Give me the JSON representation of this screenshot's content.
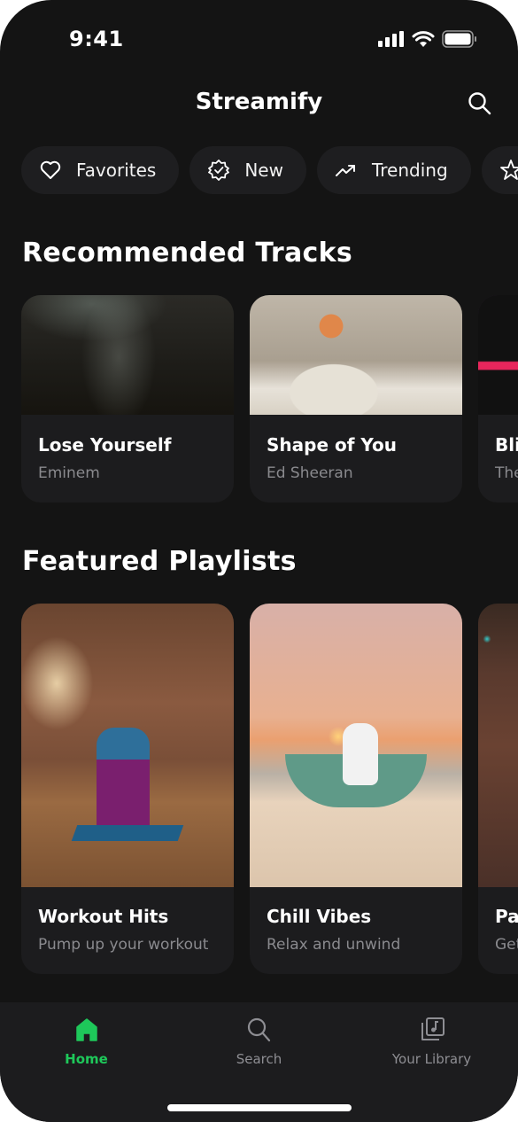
{
  "status_bar": {
    "time": "9:41"
  },
  "header": {
    "title": "Streamify"
  },
  "chips": [
    {
      "label": "Favorites",
      "icon": "heart-icon"
    },
    {
      "label": "New",
      "icon": "badge-check-icon"
    },
    {
      "label": "Trending",
      "icon": "trending-up-icon"
    },
    {
      "label": "",
      "icon": "star-icon"
    }
  ],
  "recommended": {
    "title": "Recommended Tracks",
    "items": [
      {
        "title": "Lose Yourself",
        "artist": "Eminem"
      },
      {
        "title": "Shape of You",
        "artist": "Ed Sheeran"
      },
      {
        "title": "Blinding Lights",
        "artist": "The Weeknd"
      }
    ]
  },
  "featured": {
    "title": "Featured Playlists",
    "items": [
      {
        "title": "Workout Hits",
        "subtitle": "Pump up your workout"
      },
      {
        "title": "Chill Vibes",
        "subtitle": "Relax and unwind"
      },
      {
        "title": "Party",
        "subtitle": "Get"
      }
    ]
  },
  "tabbar": {
    "items": [
      {
        "label": "Home",
        "icon": "home-icon",
        "active": true
      },
      {
        "label": "Search",
        "icon": "search-icon",
        "active": false
      },
      {
        "label": "Your Library",
        "icon": "library-icon",
        "active": false
      }
    ]
  },
  "colors": {
    "background": "#141414",
    "card": "#1c1c1e",
    "accent": "#1ec85a",
    "muted": "#8e8e93"
  }
}
